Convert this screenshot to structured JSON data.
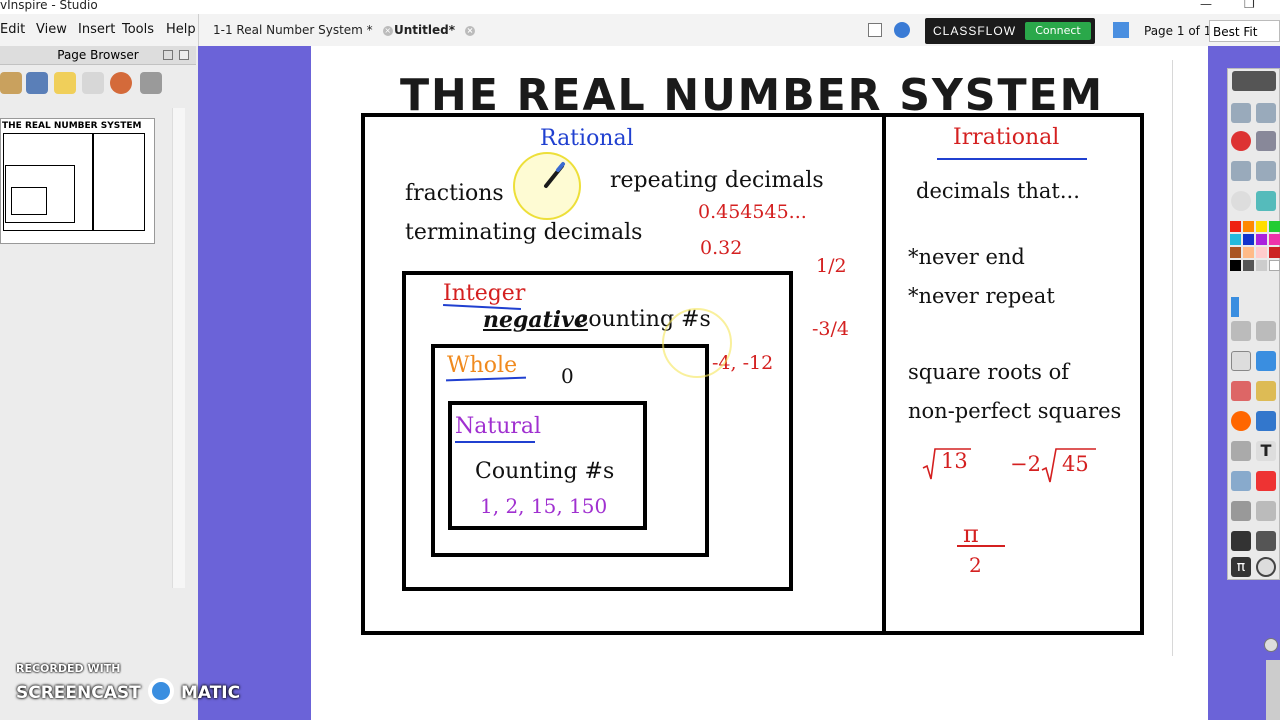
{
  "app": {
    "title": "vInspire - Studio",
    "menu": [
      "Edit",
      "View",
      "Insert",
      "Tools",
      "Help"
    ],
    "tabs": [
      {
        "label": "1-1 Real Number System *",
        "active": false
      },
      {
        "label": "Untitled*",
        "active": true
      }
    ],
    "classflow": {
      "label": "CLASSFLOW",
      "connect": "Connect"
    },
    "page_info": "Page 1 of 1",
    "zoom": "Best Fit",
    "close_glyph": "×"
  },
  "page_browser": {
    "title": "Page Browser",
    "thumbnail_title": "THE REAL NUMBER SYSTEM"
  },
  "watermark": {
    "line1": "RECORDED WITH",
    "line2": "SCREENCAST",
    "line3": "MATIC"
  },
  "flipchart": {
    "title": "THE REAL NUMBER SYSTEM",
    "rational": {
      "heading": "Rational",
      "fractions": "fractions",
      "repeating": "repeating decimals",
      "terminating": "terminating decimals",
      "ex_repeating": "0.454545...",
      "ex_terminating": "0.32",
      "ex_frac1": "1/2",
      "ex_frac2": "-3/4"
    },
    "integer": {
      "heading": "Integer",
      "negative": "negative",
      "counting": "counting #s",
      "examples": "-4, -12"
    },
    "whole": {
      "heading": "Whole",
      "example": "0"
    },
    "natural": {
      "heading": "Natural",
      "counting": "Counting #s",
      "examples": "1, 2, 15, 150"
    },
    "irrational": {
      "heading": "Irrational",
      "decimals": "decimals that...",
      "never_end": "*never end",
      "never_repeat": "*never repeat",
      "roots1": "square roots of",
      "roots2": "non-perfect squares",
      "root13": "13",
      "root45_coef": "−2",
      "root45": "45",
      "pi": "π",
      "pi_den": "2"
    }
  },
  "colors": {
    "rational": "#2040d0",
    "irrational": "#d42020",
    "whole": "#f08a1e",
    "natural": "#a030d0",
    "red_ink": "#d42020",
    "purple_ink": "#a030d0",
    "workspace": "#6b63d8"
  },
  "icons": [
    "pen-cursor-icon",
    "pen-tool-icon",
    "select-icon",
    "eraser-icon",
    "text-icon",
    "clock-icon",
    "undo-icon",
    "redo-icon"
  ]
}
